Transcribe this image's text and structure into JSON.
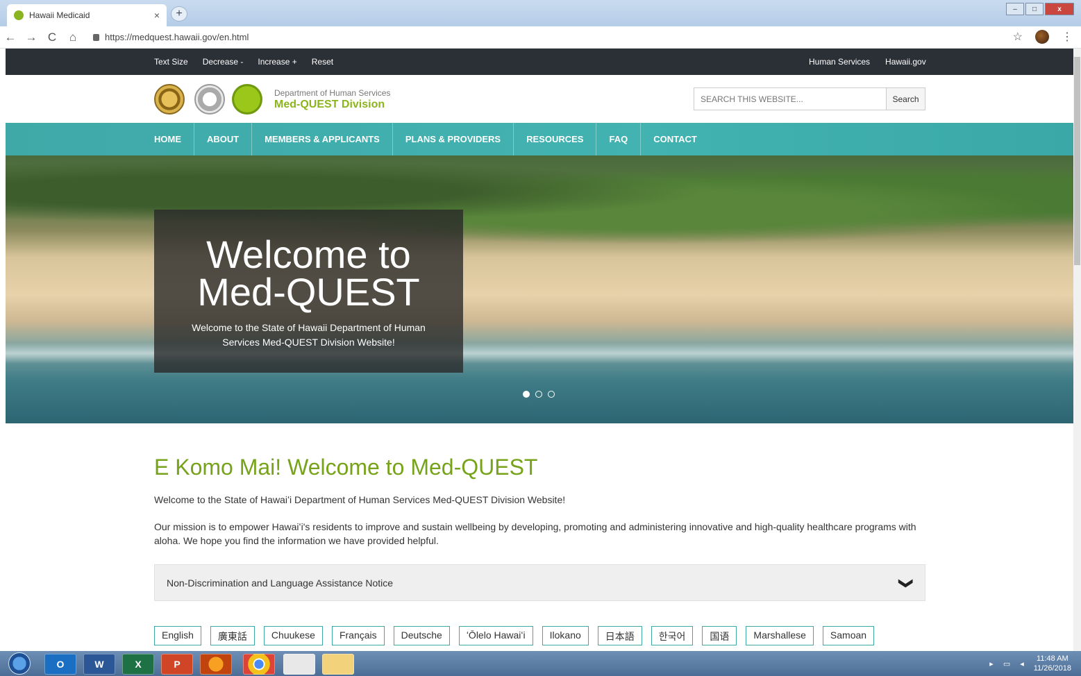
{
  "browser": {
    "tab_title": "Hawaii Medicaid",
    "tab_close": "×",
    "new_tab": "+",
    "url": "https://medquest.hawaii.gov/en.html",
    "nav": {
      "back": "←",
      "forward": "→",
      "reload": "C",
      "home": "⌂"
    },
    "bookmark_icon": "☆",
    "menu_icon": "⋮",
    "window_buttons": {
      "minimize": "–",
      "maximize": "□",
      "close": "x"
    }
  },
  "utility": {
    "text_size": "Text Size",
    "decrease": "Decrease -",
    "increase": "Increase +",
    "reset": "Reset",
    "human_services": "Human Services",
    "hawaii_gov": "Hawaii.gov"
  },
  "header": {
    "dept": "Department of Human Services",
    "division": "Med-QUEST Division",
    "search_placeholder": "SEARCH THIS WEBSITE...",
    "search_button": "Search"
  },
  "nav": {
    "items": [
      {
        "label": "HOME"
      },
      {
        "label": "ABOUT"
      },
      {
        "label": "MEMBERS & APPLICANTS"
      },
      {
        "label": "PLANS & PROVIDERS"
      },
      {
        "label": "RESOURCES"
      },
      {
        "label": "FAQ"
      },
      {
        "label": "CONTACT"
      }
    ]
  },
  "hero": {
    "title_line1": "Welcome to",
    "title_line2": "Med-QUEST",
    "subtitle": "Welcome to the State of Hawaii Department of Human Services Med-QUEST Division Website!",
    "slides": 3,
    "active_slide": 1
  },
  "main": {
    "heading": "E Komo Mai! Welcome to Med-QUEST",
    "intro": "Welcome to the State of Hawaiʻi Department of Human Services Med-QUEST Division Website!",
    "mission": "Our mission is to empower Hawaiʻi's residents to improve and sustain wellbeing by developing, promoting and administering innovative and high-quality healthcare programs with aloha. We hope you find the information we have provided helpful.",
    "accordion_label": "Non-Discrimination and Language Assistance Notice",
    "accordion_icon": "❯"
  },
  "languages": [
    "English",
    "廣東話",
    "Chuukese",
    "Français",
    "Deutsche",
    "ʻŌlelo Hawaiʻi",
    "Ilokano",
    "日本語",
    "한국어",
    "国语",
    "Marshallese",
    "Samoan"
  ],
  "taskbar": {
    "apps": [
      "O",
      "W",
      "X",
      "P",
      "",
      "",
      "",
      ""
    ],
    "time": "11:48 AM",
    "date": "11/26/2018"
  },
  "colors": {
    "green": "#77a31a",
    "teal": "#42b3b1",
    "dark": "#2b2f36"
  }
}
